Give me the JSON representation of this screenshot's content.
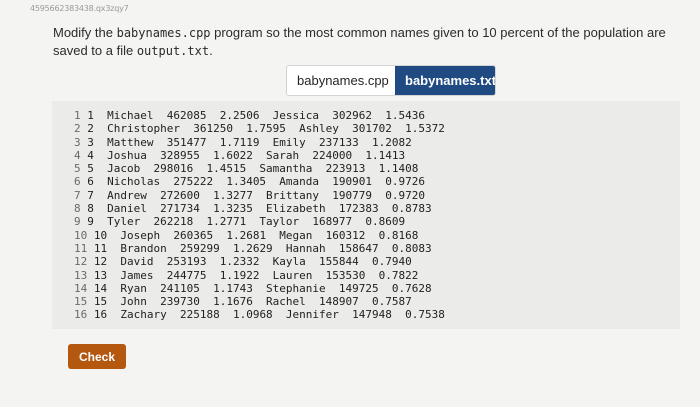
{
  "page_id": "4595662383438.qx3zqy7",
  "instructions": {
    "text_before": "Modify the ",
    "program": "babynames.cpp",
    "text_middle": " program so the most common names given to 10 percent of the population are saved to a file ",
    "output_file": "output.txt",
    "text_after": "."
  },
  "tabs": [
    {
      "label": "babynames.cpp",
      "active": false
    },
    {
      "label": "babynames.txt",
      "active": true
    }
  ],
  "file_lines": [
    {
      "num": "1",
      "content": "1  Michael  462085  2.2506  Jessica  302962  1.5436"
    },
    {
      "num": "2",
      "content": "2  Christopher  361250  1.7595  Ashley  301702  1.5372"
    },
    {
      "num": "3",
      "content": "3  Matthew  351477  1.7119  Emily  237133  1.2082"
    },
    {
      "num": "4",
      "content": "4  Joshua  328955  1.6022  Sarah  224000  1.1413"
    },
    {
      "num": "5",
      "content": "5  Jacob  298016  1.4515  Samantha  223913  1.1408"
    },
    {
      "num": "6",
      "content": "6  Nicholas  275222  1.3405  Amanda  190901  0.9726"
    },
    {
      "num": "7",
      "content": "7  Andrew  272600  1.3277  Brittany  190779  0.9720"
    },
    {
      "num": "8",
      "content": "8  Daniel  271734  1.3235  Elizabeth  172383  0.8783"
    },
    {
      "num": "9",
      "content": "9  Tyler  262218  1.2771  Taylor  168977  0.8609"
    },
    {
      "num": "10",
      "content": "10  Joseph  260365  1.2681  Megan  160312  0.8168"
    },
    {
      "num": "11",
      "content": "11  Brandon  259299  1.2629  Hannah  158647  0.8083"
    },
    {
      "num": "12",
      "content": "12  David  253193  1.2332  Kayla  155844  0.7940"
    },
    {
      "num": "13",
      "content": "13  James  244775  1.1922  Lauren  153530  0.7822"
    },
    {
      "num": "14",
      "content": "14  Ryan  241105  1.1743  Stephanie  149725  0.7628"
    },
    {
      "num": "15",
      "content": "15  John  239730  1.1676  Rachel  148907  0.7587"
    },
    {
      "num": "16",
      "content": "16  Zachary  225188  1.0968  Jennifer  147948  0.7538"
    }
  ],
  "check_button": {
    "label": "Check"
  },
  "colors": {
    "active_tab": "#1f4b82",
    "check_button": "#b4570f",
    "panel_background": "#ebebea"
  }
}
